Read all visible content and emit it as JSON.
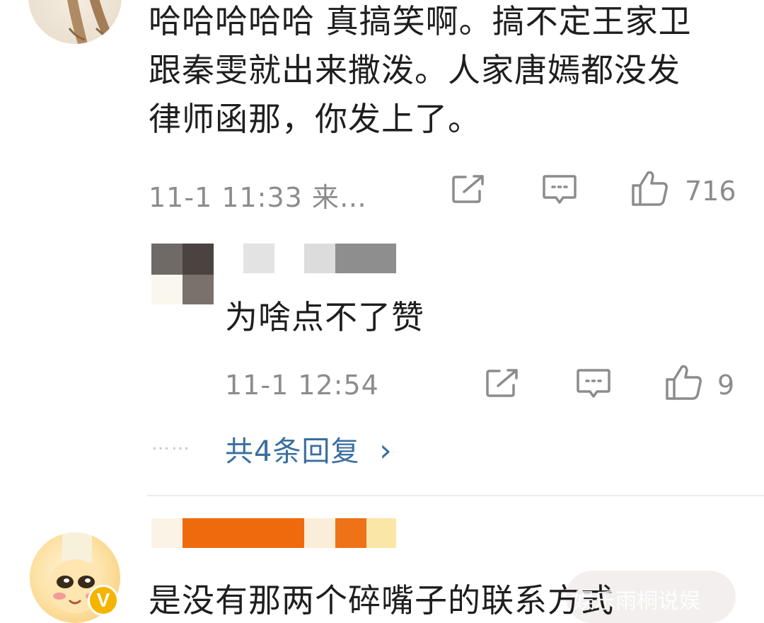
{
  "comment1": {
    "text": "哈哈哈哈哈 真搞笑啊。搞不定王家卫\n跟秦雯就出来撒泼。人家唐嫣都没发\n律师函那，你发上了。",
    "time": "11-1 11:33 来…",
    "likes": "716"
  },
  "reply": {
    "text": "为啥点不了赞",
    "time": "11-1 12:54",
    "likes": "9",
    "more_replies": "共4条回复",
    "dots": "……",
    "chevron": "›"
  },
  "comment2": {
    "text": "是没有那两个碎嘴子的联系方式",
    "verified_badge": "V"
  },
  "watermark": "娱乐雨桐说娱",
  "icons": {
    "share": "share-icon",
    "comment": "comment-icon",
    "like": "thumbs-up-icon"
  },
  "colors": {
    "link": "#3a6f9f",
    "meta": "#8c8c8c",
    "badge": "#f5b400",
    "mosaic_orange": "#ef6a0c"
  }
}
